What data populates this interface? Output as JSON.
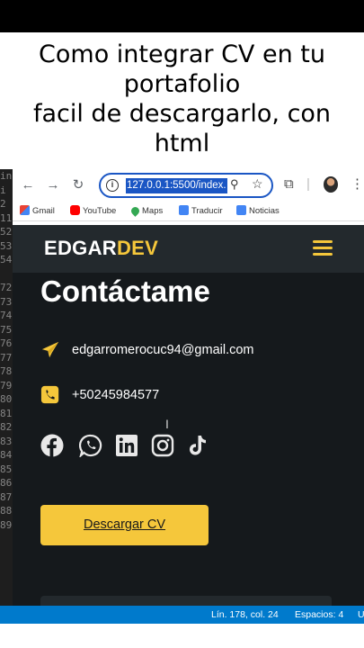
{
  "video": {
    "title_lines": [
      "Como integrar CV en tu",
      "portafolio",
      "facil de descargarlo, con",
      "html"
    ]
  },
  "editor": {
    "line_numbers": [
      "in",
      "i",
      "2",
      "11",
      "52",
      "53",
      "54",
      "",
      "72",
      "73",
      "74",
      "75",
      "76",
      "77",
      "78",
      "79",
      "80",
      "81",
      "82",
      "83",
      "84",
      "85",
      "86",
      "87",
      "88",
      "89"
    ],
    "status": {
      "position": "Lín. 178, col. 24",
      "spaces": "Espacios: 4",
      "encoding": "U"
    }
  },
  "browser": {
    "url": "127.0.0.1:5500/index.",
    "bookmarks": [
      {
        "label": "Gmail",
        "icon": "gmail-icon",
        "color": "#ea4335"
      },
      {
        "label": "YouTube",
        "icon": "youtube-icon",
        "color": "#ff0000"
      },
      {
        "label": "Maps",
        "icon": "maps-icon",
        "color": "#34a853"
      },
      {
        "label": "Traducir",
        "icon": "translate-icon",
        "color": "#4285f4"
      },
      {
        "label": "Noticias",
        "icon": "news-icon",
        "color": "#4285f4"
      }
    ]
  },
  "site": {
    "logo_main": "EDGAR",
    "logo_accent": "DEV",
    "accent_color": "#f5c73b",
    "section_title": "Contáctame",
    "email": "edgarromerocuc94@gmail.com",
    "phone": "+50245984577",
    "socials": [
      "facebook-icon",
      "whatsapp-icon",
      "linkedin-icon",
      "instagram-icon",
      "tiktok-icon"
    ],
    "cv_button": "Descargar CV"
  }
}
